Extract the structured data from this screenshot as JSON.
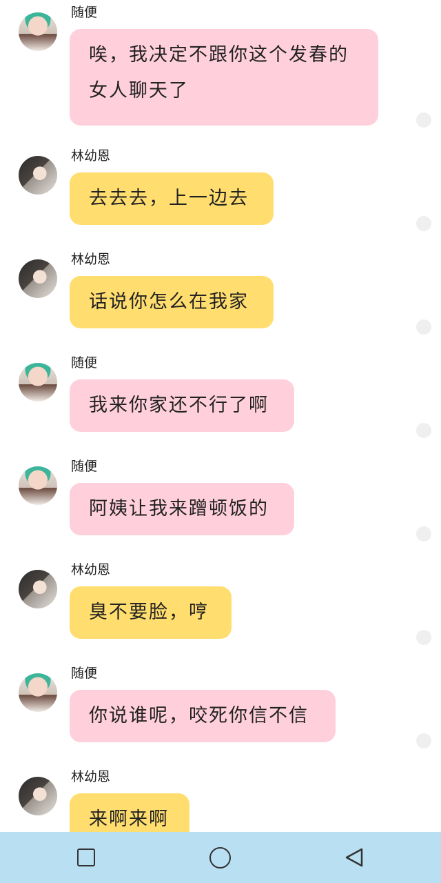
{
  "messages": [
    {
      "sender": "随便",
      "avatar": "girl-green-cap",
      "bubble_color": "#ffcfdc",
      "lines": [
        "唉，我决定不跟你这个发春的",
        "女人聊天了"
      ]
    },
    {
      "sender": "林幼恩",
      "avatar": "girl-dark-hair",
      "bubble_color": "#ffdd6e",
      "lines": [
        "去去去，上一边去"
      ]
    },
    {
      "sender": "林幼恩",
      "avatar": "girl-dark-hair",
      "bubble_color": "#ffdd6e",
      "lines": [
        "话说你怎么在我家"
      ]
    },
    {
      "sender": "随便",
      "avatar": "girl-green-cap",
      "bubble_color": "#ffcfdc",
      "lines": [
        "我来你家还不行了啊"
      ]
    },
    {
      "sender": "随便",
      "avatar": "girl-green-cap",
      "bubble_color": "#ffcfdc",
      "lines": [
        "阿姨让我来蹭顿饭的"
      ]
    },
    {
      "sender": "林幼恩",
      "avatar": "girl-dark-hair",
      "bubble_color": "#ffdd6e",
      "lines": [
        "臭不要脸，哼"
      ]
    },
    {
      "sender": "随便",
      "avatar": "girl-green-cap",
      "bubble_color": "#ffcfdc",
      "lines": [
        "你说谁呢，咬死你信不信"
      ]
    },
    {
      "sender": "林幼恩",
      "avatar": "girl-dark-hair",
      "bubble_color": "#ffdd6e",
      "lines": [
        "来啊来啊"
      ]
    }
  ],
  "navbar": {
    "icons": [
      "square-icon",
      "circle-icon",
      "back-triangle-icon"
    ],
    "background": "#b9dff3"
  }
}
